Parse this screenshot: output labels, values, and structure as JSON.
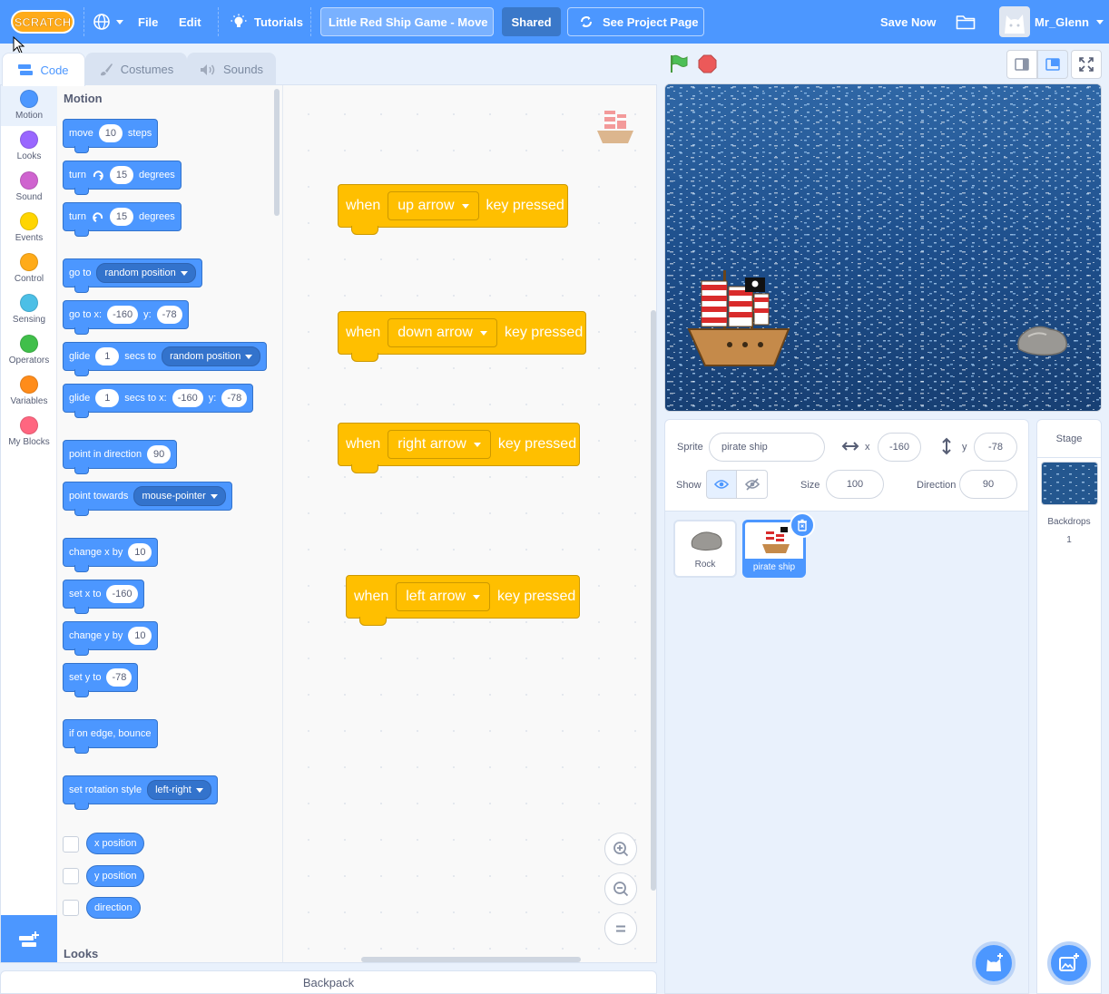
{
  "menubar": {
    "file_label": "File",
    "edit_label": "Edit",
    "tutorials_label": "Tutorials",
    "project_title": "Little Red Ship Game - Move",
    "shared_label": "Shared",
    "see_project_label": "See Project Page",
    "save_now_label": "Save Now",
    "username": "Mr_Glenn",
    "logo_text": "SCRATCH",
    "accent_color": "#4c97ff"
  },
  "tabs": [
    {
      "label": "Code"
    },
    {
      "label": "Costumes"
    },
    {
      "label": "Sounds"
    }
  ],
  "categories": [
    {
      "label": "Motion",
      "color": "#4c97ff"
    },
    {
      "label": "Looks",
      "color": "#9966ff"
    },
    {
      "label": "Sound",
      "color": "#cf63cf"
    },
    {
      "label": "Events",
      "color": "#ffd500"
    },
    {
      "label": "Control",
      "color": "#ffab19"
    },
    {
      "label": "Sensing",
      "color": "#4cbfe6"
    },
    {
      "label": "Operators",
      "color": "#40bf4a"
    },
    {
      "label": "Variables",
      "color": "#ff8c1a"
    },
    {
      "label": "My Blocks",
      "color": "#ff6680"
    }
  ],
  "palette": {
    "section_motion": "Motion",
    "section_looks": "Looks",
    "move": {
      "a": "move",
      "v": "10",
      "b": "steps"
    },
    "turn_right": {
      "a": "turn",
      "v": "15",
      "b": "degrees"
    },
    "turn_left": {
      "a": "turn",
      "v": "15",
      "b": "degrees"
    },
    "goto": {
      "a": "go to",
      "opt": "random position"
    },
    "goto_xy": {
      "a": "go to x:",
      "x": "-160",
      "b": "y:",
      "y": "-78"
    },
    "glide": {
      "a": "glide",
      "v": "1",
      "b": "secs to",
      "opt": "random position"
    },
    "glide_xy": {
      "a": "glide",
      "v": "1",
      "b": "secs to x:",
      "x": "-160",
      "c": "y:",
      "y": "-78"
    },
    "point_dir": {
      "a": "point in direction",
      "v": "90"
    },
    "point_towards": {
      "a": "point towards",
      "opt": "mouse-pointer"
    },
    "change_x": {
      "a": "change x by",
      "v": "10"
    },
    "set_x": {
      "a": "set x to",
      "v": "-160"
    },
    "change_y": {
      "a": "change y by",
      "v": "10"
    },
    "set_y": {
      "a": "set y to",
      "v": "-78"
    },
    "bounce": {
      "a": "if on edge, bounce"
    },
    "rotation": {
      "a": "set rotation style",
      "opt": "left-right"
    },
    "reporters": [
      "x position",
      "y position",
      "direction"
    ]
  },
  "scripts": [
    {
      "when": "when",
      "key": "up arrow",
      "tail": "key pressed"
    },
    {
      "when": "when",
      "key": "down arrow",
      "tail": "key pressed"
    },
    {
      "when": "when",
      "key": "right arrow",
      "tail": "key pressed"
    },
    {
      "when": "when",
      "key": "left arrow",
      "tail": "key pressed"
    }
  ],
  "backpack_label": "Backpack",
  "sprite_info": {
    "sprite_label": "Sprite",
    "sprite_name": "pirate ship",
    "x_label": "x",
    "x_value": "-160",
    "y_label": "y",
    "y_value": "-78",
    "show_label": "Show",
    "size_label": "Size",
    "size_value": "100",
    "direction_label": "Direction",
    "direction_value": "90"
  },
  "sprites": [
    {
      "name": "Rock"
    },
    {
      "name": "pirate ship"
    }
  ],
  "stage_panel": {
    "title": "Stage",
    "backdrops_label": "Backdrops",
    "backdrops_count": "1"
  }
}
